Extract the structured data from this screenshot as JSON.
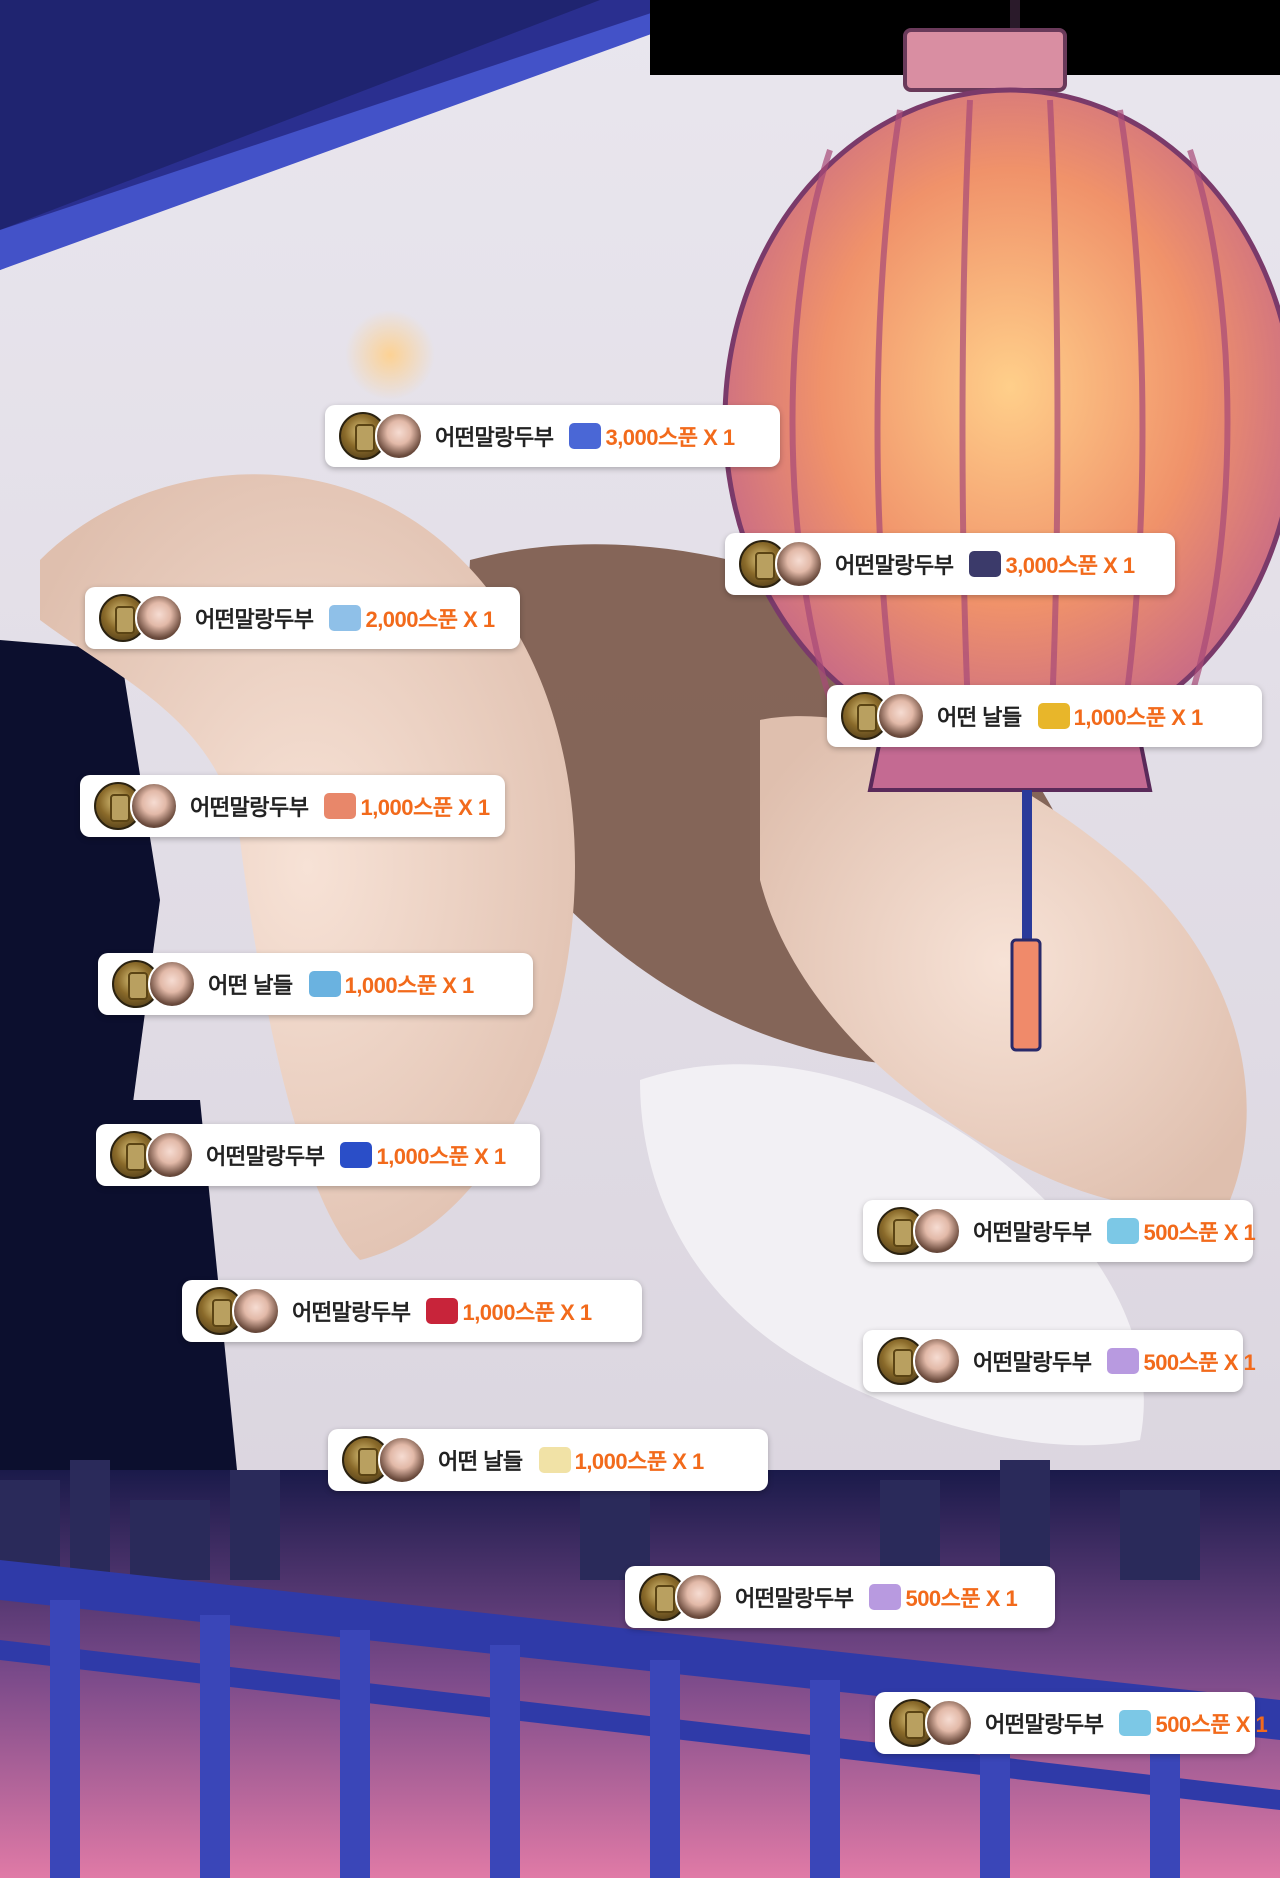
{
  "donations": [
    {
      "user": "어떤말랑두부",
      "amount": "3,000스푼 X 1",
      "icon": "blue-gift-icon",
      "icon_color": "#4a67d6"
    },
    {
      "user": "어떤말랑두부",
      "amount": "3,000스푼 X 1",
      "icon": "butterfly-gift-icon",
      "icon_color": "#3b3a6a"
    },
    {
      "user": "어떤말랑두부",
      "amount": "2,000스푼 X 1",
      "icon": "sparkle-gift-icon",
      "icon_color": "#8fc0e8"
    },
    {
      "user": "어떤 날들",
      "amount": "1,000스푼 X 1",
      "icon": "flower-field-gift-icon",
      "icon_color": "#e8b62a"
    },
    {
      "user": "어떤말랑두부",
      "amount": "1,000스푼 X 1",
      "icon": "balloon-gift-icon",
      "icon_color": "#e8876a"
    },
    {
      "user": "어떤 날들",
      "amount": "1,000스푼 X 1",
      "icon": "beach-gift-icon",
      "icon_color": "#6ab2e0"
    },
    {
      "user": "어떤말랑두부",
      "amount": "1,000스푼 X 1",
      "icon": "blue-berry-gift-icon",
      "icon_color": "#2a4ec8"
    },
    {
      "user": "어떤말랑두부",
      "amount": "500스푼 X 1",
      "icon": "wave-gift-icon",
      "icon_color": "#7cc8e6"
    },
    {
      "user": "어떤말랑두부",
      "amount": "1,000스푼 X 1",
      "icon": "cherry-gift-icon",
      "icon_color": "#c8243a"
    },
    {
      "user": "어떤말랑두부",
      "amount": "500스푼 X 1",
      "icon": "heart-gift-icon",
      "icon_color": "#b89ae0"
    },
    {
      "user": "어떤 날들",
      "amount": "1,000스푼 X 1",
      "icon": "cream-gift-icon",
      "icon_color": "#f1e2a6"
    },
    {
      "user": "어떤말랑두부",
      "amount": "500스푼 X 1",
      "icon": "heart-gift-icon",
      "icon_color": "#b89ae0"
    },
    {
      "user": "어떤말랑두부",
      "amount": "500스푼 X 1",
      "icon": "wave-gift-icon",
      "icon_color": "#7cc8e6"
    }
  ]
}
